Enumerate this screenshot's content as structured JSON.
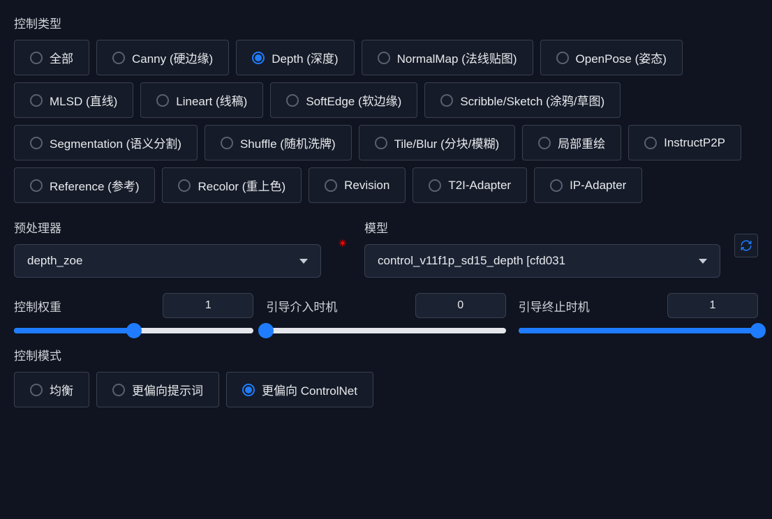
{
  "control_type": {
    "label": "控制类型",
    "options": [
      {
        "label": "全部",
        "selected": false
      },
      {
        "label": "Canny (硬边缘)",
        "selected": false
      },
      {
        "label": "Depth (深度)",
        "selected": true
      },
      {
        "label": "NormalMap (法线贴图)",
        "selected": false
      },
      {
        "label": "OpenPose (姿态)",
        "selected": false
      },
      {
        "label": "MLSD (直线)",
        "selected": false
      },
      {
        "label": "Lineart (线稿)",
        "selected": false
      },
      {
        "label": "SoftEdge (软边缘)",
        "selected": false
      },
      {
        "label": "Scribble/Sketch (涂鸦/草图)",
        "selected": false
      },
      {
        "label": "Segmentation (语义分割)",
        "selected": false
      },
      {
        "label": "Shuffle (随机洗牌)",
        "selected": false
      },
      {
        "label": "Tile/Blur (分块/模糊)",
        "selected": false
      },
      {
        "label": "局部重绘",
        "selected": false
      },
      {
        "label": "InstructP2P",
        "selected": false
      },
      {
        "label": "Reference (参考)",
        "selected": false
      },
      {
        "label": "Recolor (重上色)",
        "selected": false
      },
      {
        "label": "Revision",
        "selected": false
      },
      {
        "label": "T2I-Adapter",
        "selected": false
      },
      {
        "label": "IP-Adapter",
        "selected": false
      }
    ]
  },
  "preprocessor": {
    "label": "预处理器",
    "value": "depth_zoe"
  },
  "model": {
    "label": "模型",
    "value": "control_v11f1p_sd15_depth [cfd031"
  },
  "sliders": {
    "weight": {
      "label": "控制权重",
      "value": "1",
      "percent": 50
    },
    "start": {
      "label": "引导介入时机",
      "value": "0",
      "percent": 0
    },
    "end": {
      "label": "引导终止时机",
      "value": "1",
      "percent": 100
    }
  },
  "control_mode": {
    "label": "控制模式",
    "options": [
      {
        "label": "均衡",
        "selected": false
      },
      {
        "label": "更偏向提示词",
        "selected": false
      },
      {
        "label": "更偏向 ControlNet",
        "selected": true
      }
    ]
  }
}
